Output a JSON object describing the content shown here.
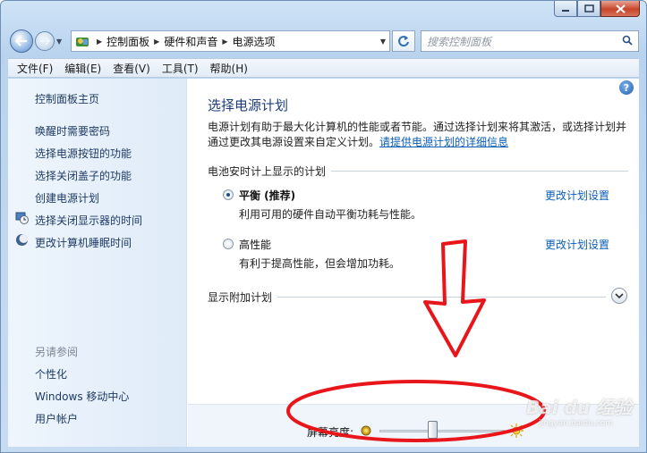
{
  "window": {
    "caption_buttons": [
      "minimize",
      "maximize",
      "close"
    ]
  },
  "nav": {
    "breadcrumbs": [
      "控制面板",
      "硬件和声音",
      "电源选项"
    ],
    "search_placeholder": "搜索控制面板"
  },
  "menu": {
    "items": [
      "文件(F)",
      "编辑(E)",
      "查看(V)",
      "工具(T)",
      "帮助(H)"
    ]
  },
  "sidebar": {
    "home": "控制面板主页",
    "links": [
      {
        "label": "唤醒时需要密码",
        "icon": ""
      },
      {
        "label": "选择电源按钮的功能",
        "icon": ""
      },
      {
        "label": "选择关闭盖子的功能",
        "icon": ""
      },
      {
        "label": "创建电源计划",
        "icon": ""
      },
      {
        "label": "选择关闭显示器的时间",
        "icon": "monitor-clock-icon"
      },
      {
        "label": "更改计算机睡眠时间",
        "icon": "moon-icon"
      }
    ],
    "see_also_heading": "另请参阅",
    "see_also": [
      "个性化",
      "Windows 移动中心",
      "用户帐户"
    ]
  },
  "main": {
    "title": "选择电源计划",
    "description": "电源计划有助于最大化计算机的性能或者节能。通过选择计划来将其激活，或选择计划并通过更改其电源设置来自定义计划。",
    "description_link": "请提供电源计划的详细信息",
    "section_label": "电池安时计上显示的计划",
    "plans": [
      {
        "name": "平衡 (推荐)",
        "desc": "利用可用的硬件自动平衡功耗与性能。",
        "selected": true,
        "change_link": "更改计划设置"
      },
      {
        "name": "高性能",
        "desc": "有利于提高性能，但会增加功耗。",
        "selected": false,
        "change_link": "更改计划设置"
      }
    ],
    "more_plans_label": "显示附加计划",
    "brightness_label": "屏幕亮度:",
    "brightness_level": 0.42
  },
  "watermark": {
    "text": "Bai du 经验",
    "sub": "jingyan.baidu.com"
  },
  "colors": {
    "link": "#0b5eb8",
    "title": "#1e3d7a",
    "annotation": "#e8151b"
  }
}
